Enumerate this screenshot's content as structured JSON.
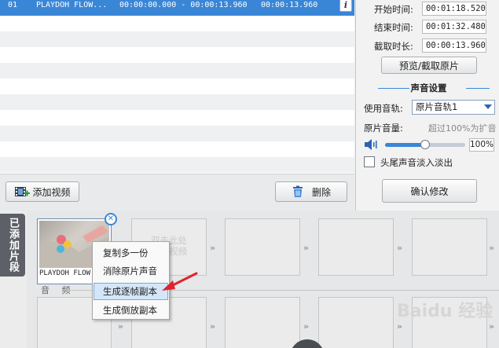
{
  "video_list": {
    "selected_row": {
      "index": "01",
      "name": "PLAYDOH FLOW...",
      "range": "00:00:00.000 - 00:00:13.960",
      "duration": "00:00:13.960"
    },
    "info_icon": "i"
  },
  "list_toolbar": {
    "add_video_label": "添加视频",
    "delete_label": "删除"
  },
  "panel": {
    "start_time_label": "开始时间:",
    "start_time": "00:01:18.520",
    "end_time_label": "结束时间:",
    "end_time": "00:01:32.480",
    "duration_label": "截取时长:",
    "duration": "00:00:13.960",
    "preview_button": "预览/截取原片",
    "audio_settings_title": "声音设置",
    "audio_track_label": "使用音轨:",
    "audio_track_value": "原片音轨1",
    "volume_label": "原片音量:",
    "volume_hint": "超过100%为扩音",
    "volume_value": "100%",
    "volume_fraction": 0.5,
    "fade_label": "头尾声音淡入淡出",
    "confirm_button": "确认修改"
  },
  "timeline": {
    "added_clips_tab": "已添加片段",
    "clip_name": "PLAYDOH FLOW...",
    "drop_hint_line1": "双击此处",
    "drop_hint_line2": "添加视频",
    "audio_label": "音 频"
  },
  "context_menu": {
    "items": [
      "复制多一份",
      "消除原片声音",
      "生成逐帧副本",
      "生成倒放副本"
    ]
  },
  "watermark": "Baidu 经验",
  "colors": {
    "selection": "#3a86d6",
    "accent_red": "#e0242c"
  }
}
